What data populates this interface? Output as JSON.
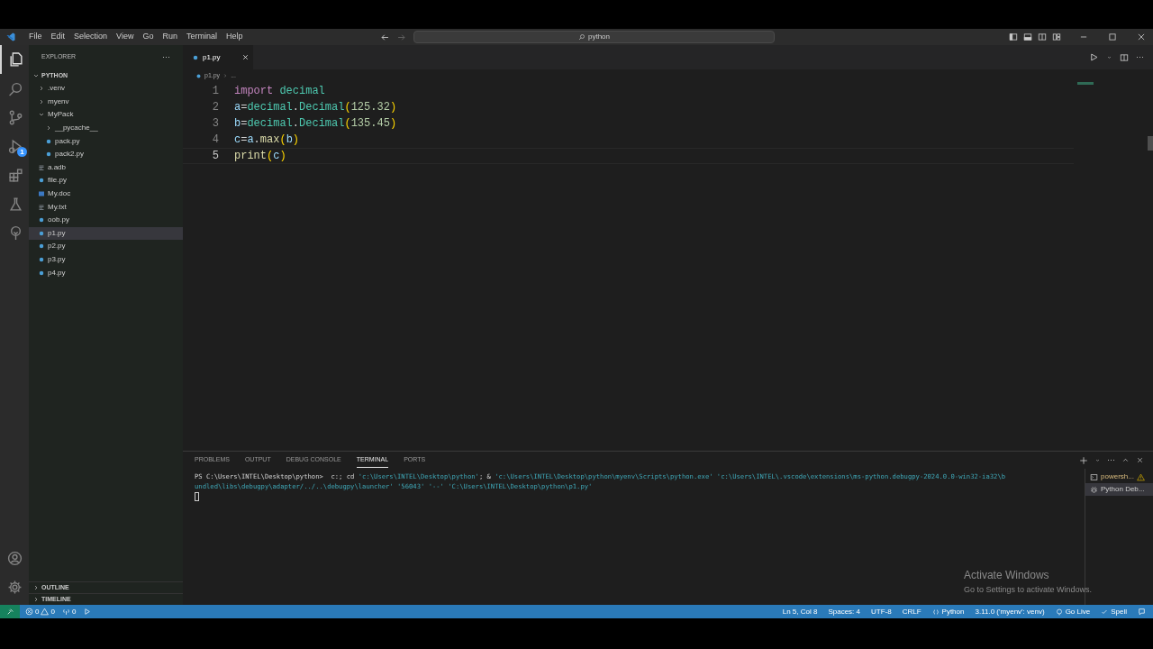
{
  "menu": [
    "File",
    "Edit",
    "Selection",
    "View",
    "Go",
    "Run",
    "Terminal",
    "Help"
  ],
  "command_center": {
    "text": "python"
  },
  "activity_bar": [
    {
      "kind": "explorer",
      "selected": true
    },
    {
      "kind": "search",
      "selected": false
    },
    {
      "kind": "source-control",
      "selected": false
    },
    {
      "kind": "run-debug",
      "selected": false,
      "badge": "1"
    },
    {
      "kind": "extensions",
      "selected": false
    },
    {
      "kind": "testing",
      "selected": false
    },
    {
      "kind": "remote",
      "selected": false
    }
  ],
  "sidebar": {
    "title": "EXPLORER",
    "more": "···",
    "root": "PYTHON",
    "tree": [
      {
        "label": ".venv",
        "kind": "folder",
        "expanded": false,
        "selected": false
      },
      {
        "label": "myenv",
        "kind": "folder",
        "expanded": false,
        "selected": false
      },
      {
        "label": "MyPack",
        "kind": "folder",
        "expanded": true,
        "selected": false,
        "children": [
          {
            "label": "__pycache__",
            "kind": "folder",
            "expanded": false,
            "selected": false
          },
          {
            "label": "pack.py",
            "kind": "python",
            "selected": false
          },
          {
            "label": "pack2.py",
            "kind": "python",
            "selected": false
          }
        ]
      },
      {
        "label": "a.adb",
        "kind": "text",
        "selected": false
      },
      {
        "label": "file.py",
        "kind": "python",
        "selected": false
      },
      {
        "label": "My.doc",
        "kind": "doc",
        "selected": false
      },
      {
        "label": "My.txt",
        "kind": "text",
        "selected": false
      },
      {
        "label": "oob.py",
        "kind": "python",
        "selected": false
      },
      {
        "label": "p1.py",
        "kind": "python",
        "selected": true
      },
      {
        "label": "p2.py",
        "kind": "python",
        "selected": false
      },
      {
        "label": "p3.py",
        "kind": "python",
        "selected": false
      },
      {
        "label": "p4.py",
        "kind": "python",
        "selected": false
      }
    ],
    "sections": [
      "OUTLINE",
      "TIMELINE"
    ]
  },
  "tabs": [
    {
      "label": "p1.py",
      "selected": true
    }
  ],
  "breadcrumb": [
    "p1.py",
    "..."
  ],
  "code": [
    {
      "number": "1",
      "tokens": [
        {
          "text": "import",
          "kind": "keyword"
        },
        {
          "text": "decimal",
          "kind": "module",
          "space_before": true
        }
      ]
    },
    {
      "number": "2",
      "tokens": [
        {
          "text": "a",
          "kind": "variable"
        },
        {
          "text": "=",
          "kind": "plain"
        },
        {
          "text": "decimal",
          "kind": "module"
        },
        {
          "text": ".",
          "kind": "plain"
        },
        {
          "text": "Decimal",
          "kind": "module"
        },
        {
          "text": "(",
          "kind": "bracket"
        },
        {
          "text": "125.32",
          "kind": "number"
        },
        {
          "text": ")",
          "kind": "bracket"
        }
      ]
    },
    {
      "number": "3",
      "tokens": [
        {
          "text": "b",
          "kind": "variable"
        },
        {
          "text": "=",
          "kind": "plain"
        },
        {
          "text": "decimal",
          "kind": "module"
        },
        {
          "text": ".",
          "kind": "plain"
        },
        {
          "text": "Decimal",
          "kind": "module"
        },
        {
          "text": "(",
          "kind": "bracket"
        },
        {
          "text": "135.45",
          "kind": "number"
        },
        {
          "text": ")",
          "kind": "bracket"
        }
      ]
    },
    {
      "number": "4",
      "tokens": [
        {
          "text": "c",
          "kind": "variable"
        },
        {
          "text": "=",
          "kind": "plain"
        },
        {
          "text": "a",
          "kind": "variable"
        },
        {
          "text": ".",
          "kind": "plain"
        },
        {
          "text": "max",
          "kind": "function"
        },
        {
          "text": "(",
          "kind": "bracket"
        },
        {
          "text": "b",
          "kind": "variable"
        },
        {
          "text": ")",
          "kind": "bracket"
        }
      ]
    },
    {
      "number": "5",
      "tokens": [
        {
          "text": "print",
          "kind": "function"
        },
        {
          "text": "(",
          "kind": "bracket"
        },
        {
          "text": "c",
          "kind": "variable"
        },
        {
          "text": ")",
          "kind": "bracket"
        }
      ]
    }
  ],
  "panel": {
    "tabs": [
      {
        "label": "PROBLEMS",
        "selected": false
      },
      {
        "label": "OUTPUT",
        "selected": false
      },
      {
        "label": "DEBUG CONSOLE",
        "selected": false
      },
      {
        "label": "TERMINAL",
        "selected": true
      },
      {
        "label": "PORTS",
        "selected": false
      }
    ],
    "terminal_lines": [
      [
        {
          "text": "PS C:\\Users\\INTEL\\Desktop\\python>  c:; cd ",
          "kind": "plain"
        },
        {
          "text": "'c:\\Users\\INTEL\\Desktop\\python'",
          "kind": "string"
        },
        {
          "text": "; & ",
          "kind": "plain"
        },
        {
          "text": "'c:\\Users\\INTEL\\Desktop\\python\\myenv\\Scripts\\python.exe' 'c:\\Users\\INTEL\\.vscode\\extensions\\ms-python.debugpy-2024.0.0-win32-ia32\\b",
          "kind": "string"
        }
      ],
      [
        {
          "text": "undled\\libs\\debugpy\\adapter/../..\\debugpy\\launcher' '56043' '--' 'C:\\Users\\INTEL\\Desktop\\python\\p1.py'",
          "kind": "string"
        }
      ]
    ],
    "terminals": [
      {
        "label": "powersh...",
        "kind": "powershell",
        "selected": false,
        "warning": true
      },
      {
        "label": "Python Deb...",
        "kind": "debug",
        "selected": true,
        "warning": false
      }
    ]
  },
  "activation": {
    "title": "Activate Windows",
    "text": "Go to Settings to activate Windows."
  },
  "status_bar": {
    "errors": "0",
    "warnings": "0",
    "ports": "0",
    "right": [
      "Ln 5, Col 8",
      "Spaces: 4",
      "UTF-8",
      "CRLF",
      "Python",
      "3.11.0 ('myenv': venv)",
      "Go Live",
      "Spell"
    ]
  }
}
